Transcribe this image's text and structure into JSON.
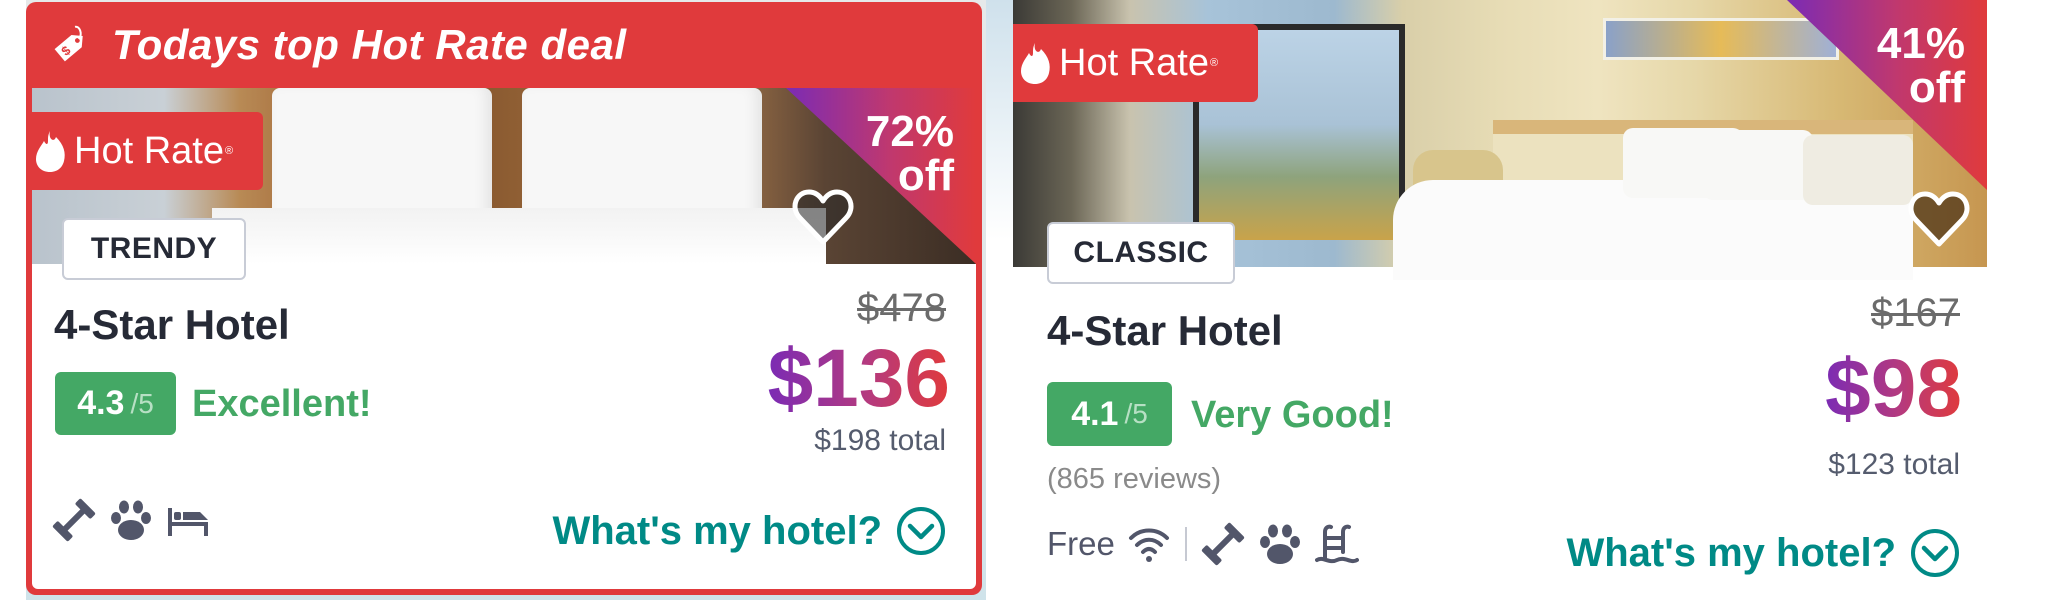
{
  "featured_banner": {
    "icon": "price-tag-icon",
    "title": "Todays top Hot Rate deal"
  },
  "colors": {
    "hot_rate_red": "#e03a3c",
    "price_gradient_start": "#7b2bb4",
    "price_gradient_end": "#e03a3c",
    "rating_green": "#44a865",
    "link_teal": "#008a86",
    "text_dark": "#262a36"
  },
  "cards": [
    {
      "hot_rate_label": "Hot Rate",
      "registered_mark": "®",
      "discount_percent": "72%",
      "discount_suffix": "off",
      "style_tag": "TRENDY",
      "hotel_name": "4-Star Hotel",
      "rating_score": "4.3",
      "rating_out_of": "/5",
      "rating_text": "Excellent!",
      "old_price": "$478",
      "price": "$136",
      "total_price": "$198 total",
      "amenities": [
        "fitness-icon",
        "pet-friendly-icon",
        "bed-icon"
      ],
      "whats_my_hotel": "What's my hotel?"
    },
    {
      "hot_rate_label": "Hot Rate",
      "registered_mark": "®",
      "discount_percent": "41%",
      "discount_suffix": "off",
      "style_tag": "CLASSIC",
      "hotel_name": "4-Star Hotel",
      "rating_score": "4.1",
      "rating_out_of": "/5",
      "rating_text": "Very Good!",
      "reviews": "(865 reviews)",
      "old_price": "$167",
      "price": "$98",
      "total_price": "$123 total",
      "amenities_prefix": "Free",
      "amenities": [
        "wifi-icon",
        "fitness-icon",
        "pet-friendly-icon",
        "pool-icon"
      ],
      "whats_my_hotel": "What's my hotel?"
    }
  ]
}
